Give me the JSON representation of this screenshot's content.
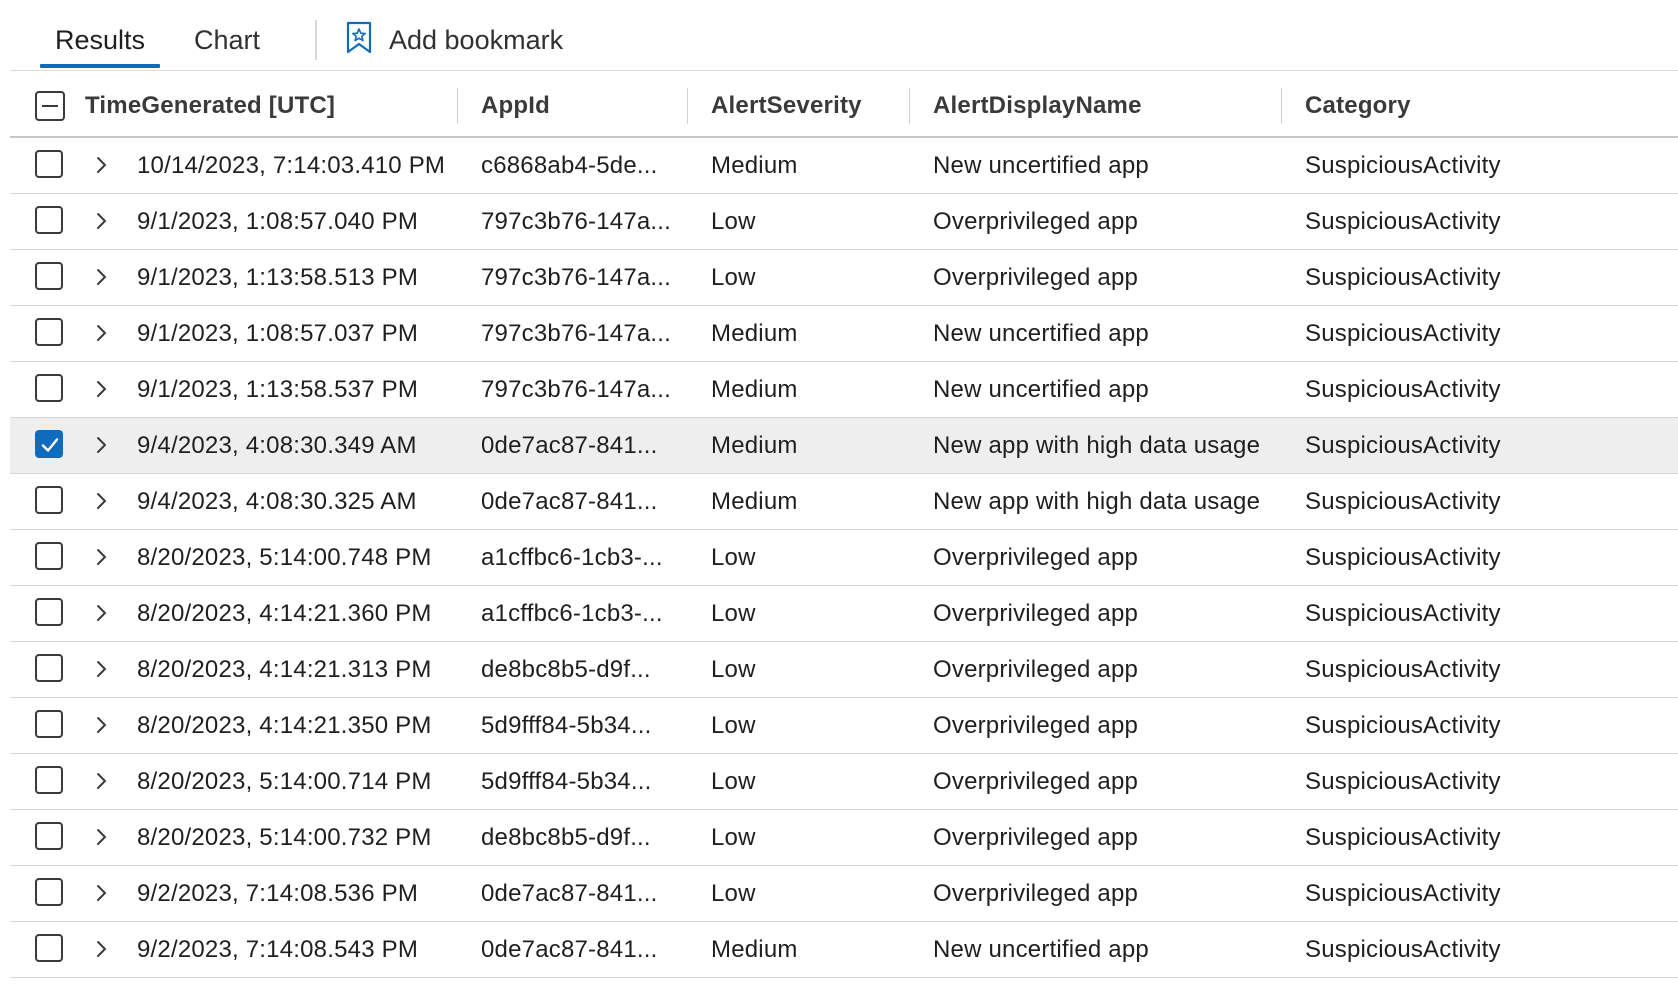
{
  "toolbar": {
    "tabs": [
      {
        "label": "Results",
        "active": true
      },
      {
        "label": "Chart",
        "active": false
      }
    ],
    "bookmark_label": "Add bookmark",
    "bookmark_icon": "bookmark-star-icon",
    "accent_color": "#0f6cbd"
  },
  "grid": {
    "columns": [
      "TimeGenerated [UTC]",
      "AppId",
      "AlertSeverity",
      "AlertDisplayName",
      "Category"
    ],
    "rows": [
      {
        "time": "10/14/2023, 7:14:03.410 PM",
        "appid": "c6868ab4-5de...",
        "severity": "Medium",
        "name": "New uncertified app",
        "category": "SuspiciousActivity",
        "checked": false
      },
      {
        "time": "9/1/2023, 1:08:57.040 PM",
        "appid": "797c3b76-147a...",
        "severity": "Low",
        "name": "Overprivileged app",
        "category": "SuspiciousActivity",
        "checked": false
      },
      {
        "time": "9/1/2023, 1:13:58.513 PM",
        "appid": "797c3b76-147a...",
        "severity": "Low",
        "name": "Overprivileged app",
        "category": "SuspiciousActivity",
        "checked": false
      },
      {
        "time": "9/1/2023, 1:08:57.037 PM",
        "appid": "797c3b76-147a...",
        "severity": "Medium",
        "name": "New uncertified app",
        "category": "SuspiciousActivity",
        "checked": false
      },
      {
        "time": "9/1/2023, 1:13:58.537 PM",
        "appid": "797c3b76-147a...",
        "severity": "Medium",
        "name": "New uncertified app",
        "category": "SuspiciousActivity",
        "checked": false
      },
      {
        "time": "9/4/2023, 4:08:30.349 AM",
        "appid": "0de7ac87-841...",
        "severity": "Medium",
        "name": "New app with high data usage",
        "category": "SuspiciousActivity",
        "checked": true
      },
      {
        "time": "9/4/2023, 4:08:30.325 AM",
        "appid": "0de7ac87-841...",
        "severity": "Medium",
        "name": "New app with high data usage",
        "category": "SuspiciousActivity",
        "checked": false
      },
      {
        "time": "8/20/2023, 5:14:00.748 PM",
        "appid": "a1cffbc6-1cb3-...",
        "severity": "Low",
        "name": "Overprivileged app",
        "category": "SuspiciousActivity",
        "checked": false
      },
      {
        "time": "8/20/2023, 4:14:21.360 PM",
        "appid": "a1cffbc6-1cb3-...",
        "severity": "Low",
        "name": "Overprivileged app",
        "category": "SuspiciousActivity",
        "checked": false
      },
      {
        "time": "8/20/2023, 4:14:21.313 PM",
        "appid": "de8bc8b5-d9f...",
        "severity": "Low",
        "name": "Overprivileged app",
        "category": "SuspiciousActivity",
        "checked": false
      },
      {
        "time": "8/20/2023, 4:14:21.350 PM",
        "appid": "5d9fff84-5b34...",
        "severity": "Low",
        "name": "Overprivileged app",
        "category": "SuspiciousActivity",
        "checked": false
      },
      {
        "time": "8/20/2023, 5:14:00.714 PM",
        "appid": "5d9fff84-5b34...",
        "severity": "Low",
        "name": "Overprivileged app",
        "category": "SuspiciousActivity",
        "checked": false
      },
      {
        "time": "8/20/2023, 5:14:00.732 PM",
        "appid": "de8bc8b5-d9f...",
        "severity": "Low",
        "name": "Overprivileged app",
        "category": "SuspiciousActivity",
        "checked": false
      },
      {
        "time": "9/2/2023, 7:14:08.536 PM",
        "appid": "0de7ac87-841...",
        "severity": "Low",
        "name": "Overprivileged app",
        "category": "SuspiciousActivity",
        "checked": false
      },
      {
        "time": "9/2/2023, 7:14:08.543 PM",
        "appid": "0de7ac87-841...",
        "severity": "Medium",
        "name": "New uncertified app",
        "category": "SuspiciousActivity",
        "checked": false
      }
    ]
  }
}
